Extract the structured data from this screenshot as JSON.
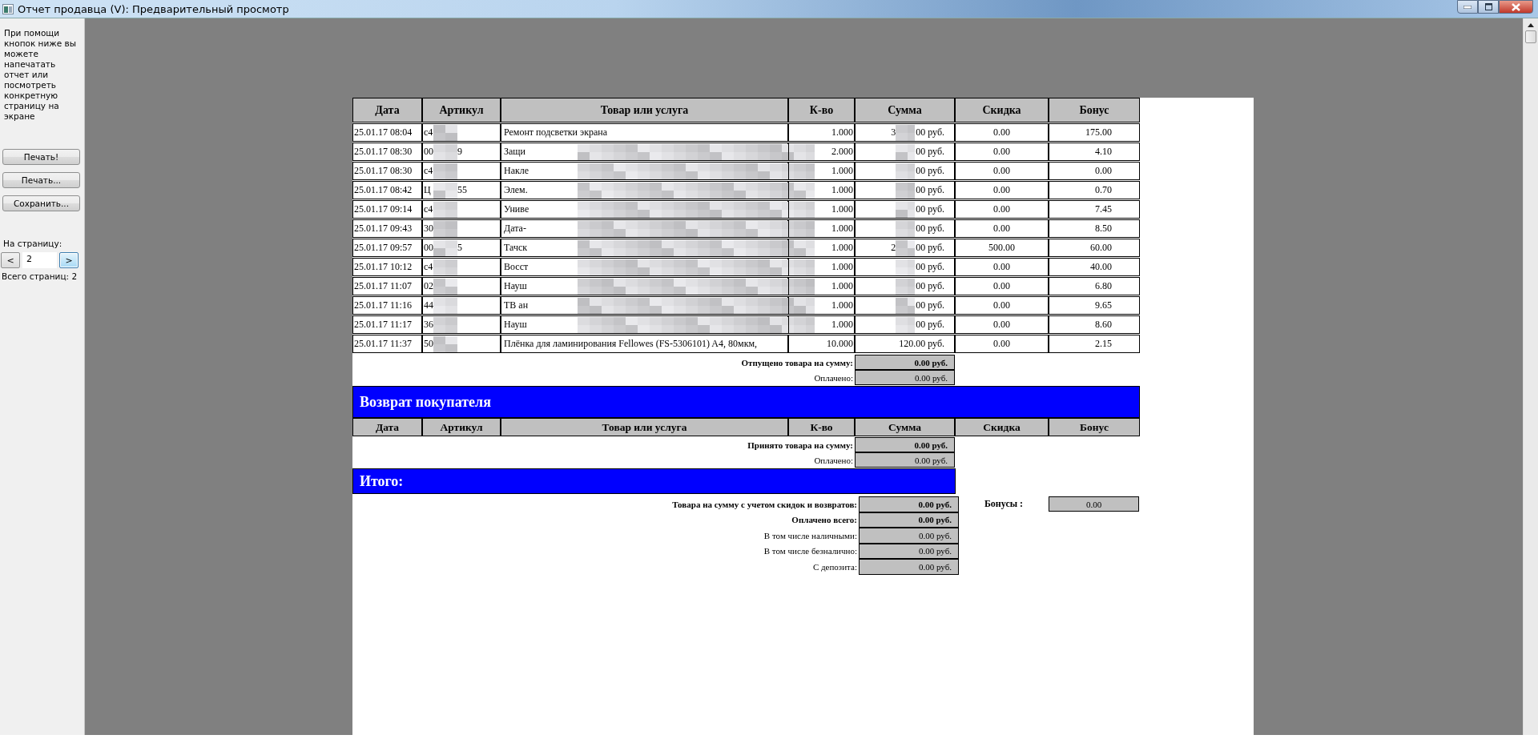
{
  "window": {
    "title": "Отчет продавца (V): Предварительный просмотр"
  },
  "sidebar": {
    "hint": "При помощи кнопок ниже вы можете напечатать отчет или посмотреть конкретную страницу на экране",
    "buttons": [
      "Печать!",
      "Печать...",
      "Сохранить..."
    ],
    "page_label": "На страницу:",
    "prev": "<",
    "page": "2",
    "next": ">",
    "next_focused": true,
    "total_pages": "Всего страниц: 2"
  },
  "report": {
    "sales": {
      "columns": [
        "Дата",
        "Артикул",
        "Товар или услуга",
        "К-во",
        "Сумма",
        "Скидка",
        "Бонус"
      ],
      "rows": [
        {
          "date": "25.01.17 08:04",
          "article": {
            "start": "c4"
          },
          "product": {
            "text": "Ремонт подсветки экрана",
            "masked": false
          },
          "qty": "1.000",
          "sum": {
            "start": "3",
            "end": "00 руб.",
            "masked": true
          },
          "discount": "0.00",
          "bonus": "175.00"
        },
        {
          "date": "25.01.17 08:30",
          "article": {
            "start": "00",
            "end": "9"
          },
          "product": {
            "text": "Защи",
            "masked": true
          },
          "qty": "2.000",
          "sum": {
            "end": "00 руб.",
            "masked": true
          },
          "discount": "0.00",
          "bonus": "4.10"
        },
        {
          "date": "25.01.17 08:30",
          "article": {
            "start": "c4"
          },
          "product": {
            "text": "Накле",
            "masked": true
          },
          "qty": "1.000",
          "sum": {
            "end": "00 руб.",
            "masked": true
          },
          "discount": "0.00",
          "bonus": "0.00"
        },
        {
          "date": "25.01.17 08:42",
          "article": {
            "start": "Ц",
            "end": "55"
          },
          "product": {
            "text": "Элем.",
            "masked": true
          },
          "qty": "1.000",
          "sum": {
            "end": "00 руб.",
            "masked": true
          },
          "discount": "0.00",
          "bonus": "0.70"
        },
        {
          "date": "25.01.17 09:14",
          "article": {
            "start": "c4"
          },
          "product": {
            "text": "Униве",
            "masked": true
          },
          "qty": "1.000",
          "sum": {
            "end": "00 руб.",
            "masked": true
          },
          "discount": "0.00",
          "bonus": "7.45"
        },
        {
          "date": "25.01.17 09:43",
          "article": {
            "start": "30"
          },
          "product": {
            "text": "Дата-",
            "masked": true
          },
          "qty": "1.000",
          "sum": {
            "end": "00 руб.",
            "masked": true
          },
          "discount": "0.00",
          "bonus": "8.50"
        },
        {
          "date": "25.01.17 09:57",
          "article": {
            "start": "00",
            "end": "5"
          },
          "product": {
            "text": "Тачск",
            "masked": true
          },
          "qty": "1.000",
          "sum": {
            "start": "2",
            "end": "00 руб.",
            "masked": true
          },
          "discount": "500.00",
          "bonus": "60.00"
        },
        {
          "date": "25.01.17 10:12",
          "article": {
            "start": "c4"
          },
          "product": {
            "text": "Восст",
            "masked": true
          },
          "qty": "1.000",
          "sum": {
            "end": "00 руб.",
            "masked": true
          },
          "discount": "0.00",
          "bonus": "40.00"
        },
        {
          "date": "25.01.17 11:07",
          "article": {
            "start": "02"
          },
          "product": {
            "text": "Науш",
            "masked": true
          },
          "qty": "1.000",
          "sum": {
            "end": "00 руб.",
            "masked": true
          },
          "discount": "0.00",
          "bonus": "6.80"
        },
        {
          "date": "25.01.17 11:16",
          "article": {
            "start": "44"
          },
          "product": {
            "text": "ТВ ан",
            "masked": true
          },
          "qty": "1.000",
          "sum": {
            "end": "00 руб.",
            "masked": true
          },
          "discount": "0.00",
          "bonus": "9.65"
        },
        {
          "date": "25.01.17 11:17",
          "article": {
            "start": "36"
          },
          "product": {
            "text": "Науш",
            "masked": true
          },
          "qty": "1.000",
          "sum": {
            "end": "00 руб.",
            "masked": true
          },
          "discount": "0.00",
          "bonus": "8.60"
        },
        {
          "date": "25.01.17 11:37",
          "article": {
            "start": "50"
          },
          "product": {
            "text": "Плёнка для ламинирования Fellowes (FS-5306101) A4, 80мкм,",
            "masked": false
          },
          "qty": "10.000",
          "sum": {
            "end": "120.00 руб.",
            "masked": false
          },
          "discount": "0.00",
          "bonus": "2.15"
        }
      ],
      "summary": [
        {
          "label": "Отпущено товара на сумму:",
          "value": "0.00 руб.",
          "bold": true
        },
        {
          "label": "Оплачено:",
          "value": "0.00 руб.",
          "bold": false
        }
      ]
    },
    "returns": {
      "title": "Возврат покупателя",
      "columns": [
        "Дата",
        "Артикул",
        "Товар или услуга",
        "К-во",
        "Сумма",
        "Скидка",
        "Бонус"
      ],
      "summary": [
        {
          "label": "Принято товара на сумму:",
          "value": "0.00 руб.",
          "bold": true
        },
        {
          "label": "Оплачено:",
          "value": "0.00 руб.",
          "bold": false
        }
      ]
    },
    "total": {
      "title": "Итого:",
      "lines": [
        {
          "label": "Товара на сумму с учетом скидок и возвратов:",
          "value": "0.00 руб.",
          "bold": true
        },
        {
          "label": "Оплачено всего:",
          "value": "0.00 руб.",
          "bold": true
        },
        {
          "label": "В том числе наличными:",
          "value": "0.00 руб.",
          "bold": false
        },
        {
          "label": "В том числе безналично:",
          "value": "0.00 руб.",
          "bold": false
        },
        {
          "label": "С депозита:",
          "value": "0.00 руб.",
          "bold": false
        }
      ],
      "bonus": {
        "label": "Бонусы :",
        "value": "0.00"
      }
    }
  }
}
